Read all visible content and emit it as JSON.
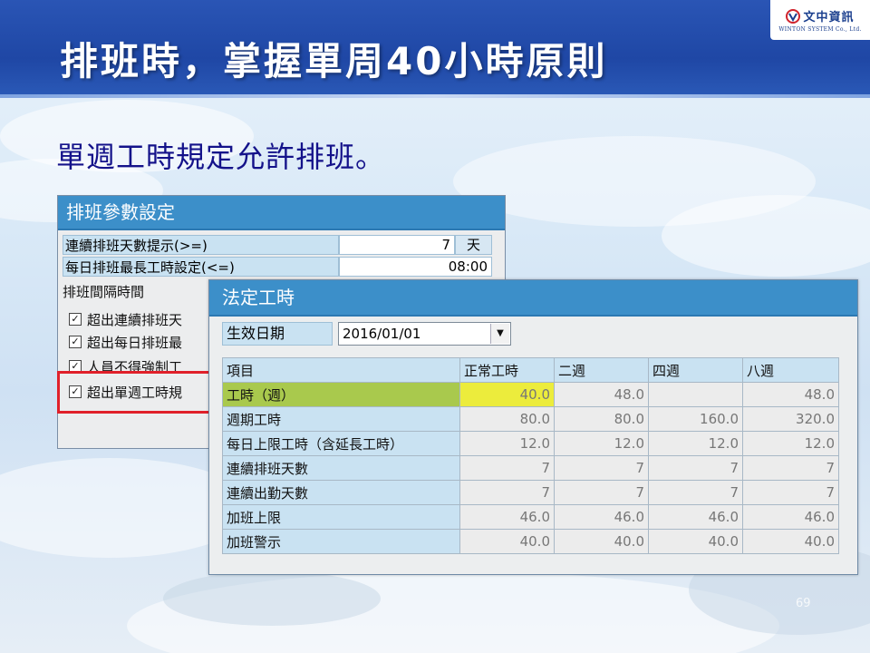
{
  "header": {
    "title": "排班時，掌握單周40小時原則",
    "logo_name": "文中資訊",
    "logo_sub": "WINTON SYSTEM Co., Ltd."
  },
  "subtitle": "單週工時規定允許排班。",
  "dialog1": {
    "title": "排班參數設定",
    "consecutive_label": "連續排班天數提示(>=)",
    "consecutive_value": "7",
    "consecutive_unit": "天",
    "daily_max_label": "每日排班最長工時設定(<=)",
    "daily_max_value": "08:00",
    "interval_label": "排班間隔時間",
    "checks": [
      {
        "label": "超出連續排班天",
        "checked": true
      },
      {
        "label": "超出每日排班最",
        "checked": true
      },
      {
        "label": "人員不得強制工",
        "checked": true
      },
      {
        "label": "超出單週工時規",
        "checked": true
      }
    ]
  },
  "dialog2": {
    "title": "法定工時",
    "effective_date_label": "生效日期",
    "effective_date_value": "2016/01/01",
    "columns": [
      "項目",
      "正常工時",
      "二週",
      "四週",
      "八週"
    ],
    "rows": [
      {
        "label": "工時（週）",
        "values": [
          "40.0",
          "48.0",
          "",
          "48.0"
        ]
      },
      {
        "label": "週期工時",
        "values": [
          "80.0",
          "80.0",
          "160.0",
          "320.0"
        ]
      },
      {
        "label": "每日上限工時（含延長工時）",
        "values": [
          "12.0",
          "12.0",
          "12.0",
          "12.0"
        ]
      },
      {
        "label": "連續排班天數",
        "values": [
          "7",
          "7",
          "7",
          "7"
        ]
      },
      {
        "label": "連續出勤天數",
        "values": [
          "7",
          "7",
          "7",
          "7"
        ]
      },
      {
        "label": "加班上限",
        "values": [
          "46.0",
          "46.0",
          "46.0",
          "46.0"
        ]
      },
      {
        "label": "加班警示",
        "values": [
          "40.0",
          "40.0",
          "40.0",
          "40.0"
        ]
      }
    ]
  },
  "page_number": "69",
  "colors": {
    "header_blue": "#1f47a5",
    "title_bar_blue": "#3c8fc9",
    "label_cell": "#c9e2f2",
    "highlight_row_label": "#a9c94d",
    "highlight_cell": "#ecec3c",
    "red_frame": "#e0202a"
  }
}
